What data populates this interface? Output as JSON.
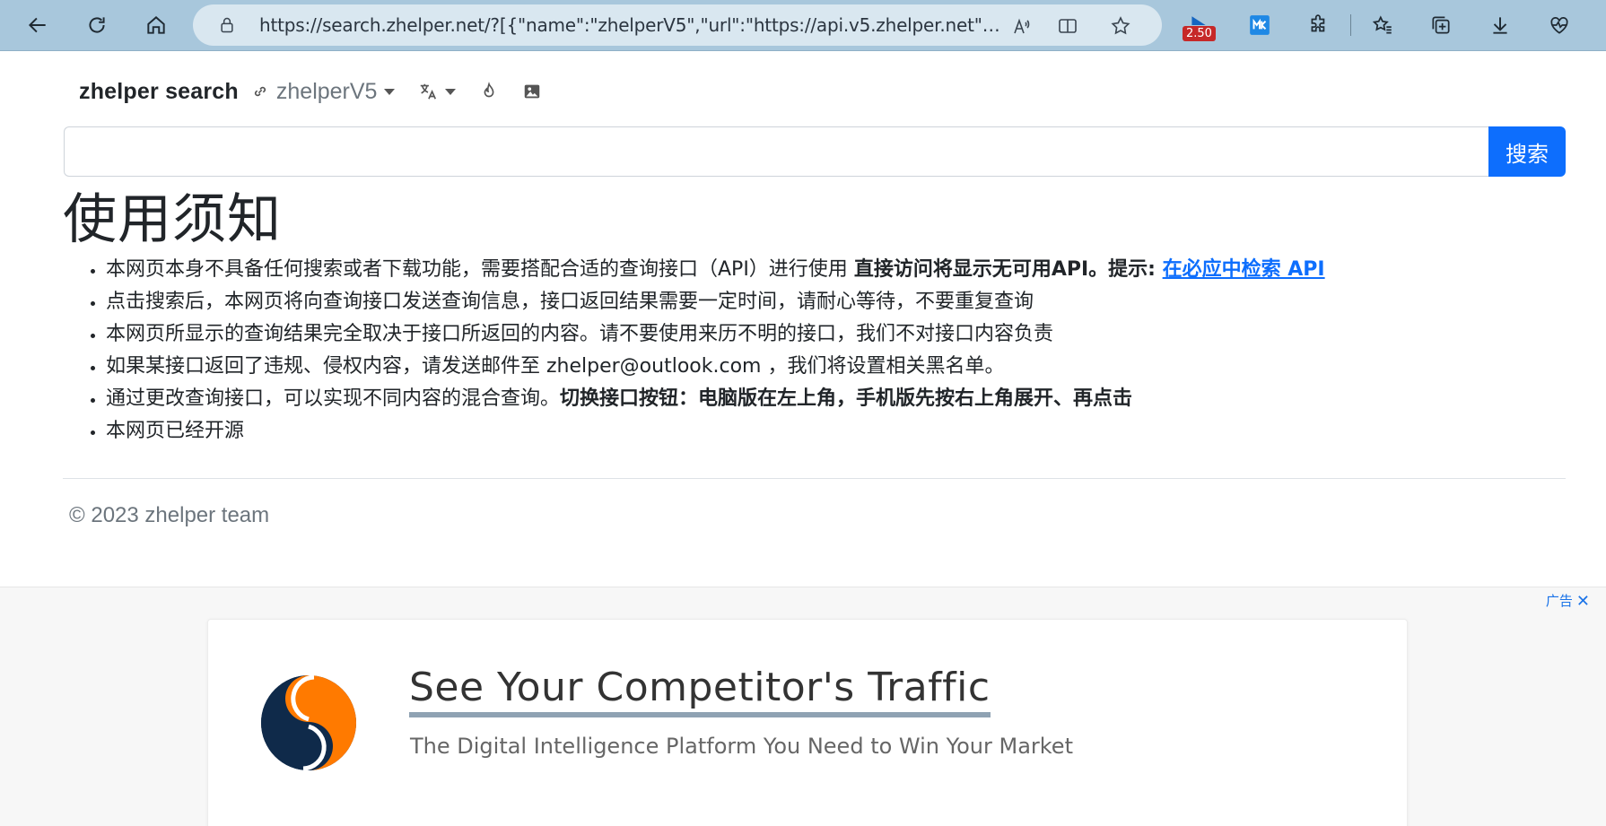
{
  "browser": {
    "url": "https://search.zhelper.net/?[{\"name\":\"zhelperV5\",\"url\":\"https://api.v5.zhelper.net\",\"type...",
    "extension_badge": "2.50"
  },
  "nav": {
    "brand": "zhelper search",
    "api_name": "zhelperV5"
  },
  "search": {
    "input_value": "",
    "button_label": "搜索"
  },
  "notice": {
    "heading": "使用须知",
    "items": [
      {
        "text": "本网页本身不具备任何搜索或者下载功能，需要搭配合适的查询接口（API）进行使用 ",
        "bold": "直接访问将显示无可用API。提示: ",
        "link": "在必应中检索 API"
      },
      {
        "text": "点击搜索后，本网页将向查询接口发送查询信息，接口返回结果需要一定时间，请耐心等待，不要重复查询"
      },
      {
        "text": "本网页所显示的查询结果完全取决于接口所返回的内容。请不要使用来历不明的接口，我们不对接口内容负责"
      },
      {
        "text": "如果某接口返回了违规、侵权内容，请发送邮件至 zhelper@outlook.com ，我们将设置相关黑名单。"
      },
      {
        "text": "通过更改查询接口，可以实现不同内容的混合查询。",
        "bold": "切换接口按钮：电脑版在左上角，手机版先按右上角展开、再点击"
      },
      {
        "text": "本网页已经开源"
      }
    ]
  },
  "footer": {
    "text": "© 2023 zhelper team"
  },
  "ad": {
    "label": "广告",
    "title": "See Your Competitor's Traffic",
    "subtitle": "The Digital Intelligence Platform You Need to Win Your Market",
    "logo_colors": {
      "navy": "#0f2a4a",
      "orange": "#ff7a00"
    }
  },
  "colors": {
    "accent": "#0d6efd",
    "chrome": "#a8c7dc"
  }
}
